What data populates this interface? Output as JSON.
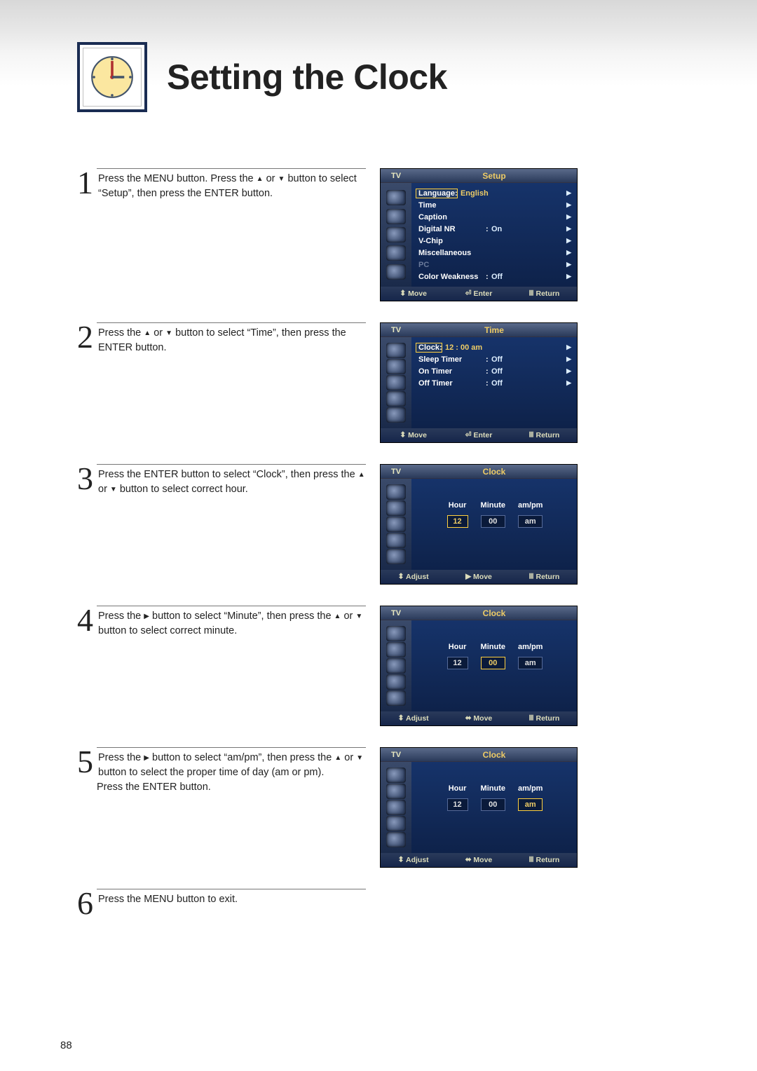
{
  "header": {
    "title": "Setting the Clock"
  },
  "glyph": {
    "up": "▲",
    "down": "▼",
    "left": "◀",
    "right": "▶",
    "updown": "⬍",
    "leftright": "⬌",
    "enter": "⏎",
    "return": "⏏"
  },
  "steps": {
    "s1": {
      "num": "1",
      "text_a": "Press the MENU button. Press the ",
      "text_b": " or ",
      "text_c": " button to select “Setup”, then press the ENTER button."
    },
    "s2": {
      "num": "2",
      "text_a": "Press the ",
      "text_b": " or ",
      "text_c": " button to select “Time”, then press the ENTER button."
    },
    "s3": {
      "num": "3",
      "text_a": "Press the ENTER button to select “Clock”, then press the ",
      "text_b": " or ",
      "text_c": " button to select correct hour."
    },
    "s4": {
      "num": "4",
      "text_a": "Press the ",
      "text_b": " button to select “Minute”, then press the ",
      "text_c": " or ",
      "text_d": " button to select correct minute."
    },
    "s5": {
      "num": "5",
      "text_a": "Press the ",
      "text_b": " button to select “am/pm”, then press the ",
      "text_c": " or ",
      "text_d": " button to select the proper time of day (am or pm).",
      "text_e": "Press the ENTER button."
    },
    "s6": {
      "num": "6",
      "text": "Press the MENU button to exit."
    }
  },
  "osd_common": {
    "tv": "TV",
    "move": "Move",
    "adjust": "Adjust",
    "enter": "Enter",
    "return": "Return"
  },
  "osd1": {
    "title": "Setup",
    "rows": [
      {
        "label": "Language",
        "value": "English",
        "arrow": true,
        "highlight": true
      },
      {
        "label": "Time",
        "value": "",
        "arrow": true
      },
      {
        "label": "Caption",
        "value": "",
        "arrow": true
      },
      {
        "label": "Digital NR",
        "value": "On",
        "arrow": true
      },
      {
        "label": "V-Chip",
        "value": "",
        "arrow": true
      },
      {
        "label": "Miscellaneous",
        "value": "",
        "arrow": true
      },
      {
        "label": "PC",
        "value": "",
        "arrow": true,
        "dim": true
      },
      {
        "label": "Color Weakness",
        "value": "Off",
        "arrow": true
      }
    ]
  },
  "osd2": {
    "title": "Time",
    "rows": [
      {
        "label": "Clock",
        "value": "12 : 00 am",
        "arrow": true,
        "highlight": true
      },
      {
        "label": "Sleep Timer",
        "value": "Off",
        "arrow": true
      },
      {
        "label": "On Timer",
        "value": "Off",
        "arrow": true
      },
      {
        "label": "Off Timer",
        "value": "Off",
        "arrow": true
      }
    ]
  },
  "clock_labels": {
    "hour": "Hour",
    "minute": "Minute",
    "ampm": "am/pm"
  },
  "osd3": {
    "title": "Clock",
    "hour": "12",
    "minute": "00",
    "ampm": "am",
    "sel": "hour"
  },
  "osd4": {
    "title": "Clock",
    "hour": "12",
    "minute": "00",
    "ampm": "am",
    "sel": "minute"
  },
  "osd5": {
    "title": "Clock",
    "hour": "12",
    "minute": "00",
    "ampm": "am",
    "sel": "ampm"
  },
  "page_number": "88"
}
